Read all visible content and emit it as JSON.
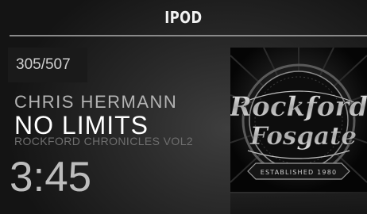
{
  "header": {
    "title": "IPOD"
  },
  "now_playing": {
    "track_counter": "305/507",
    "artist": "CHRIS HERMANN",
    "song": "NO LIMITS",
    "album": "ROCKFORD CHRONICLES VOL2",
    "elapsed_time": "3:45"
  },
  "album_art": {
    "logo_line1": "Rockford",
    "logo_line2": "Fosgate",
    "logo_banner": "ESTABLISHED 1980"
  }
}
